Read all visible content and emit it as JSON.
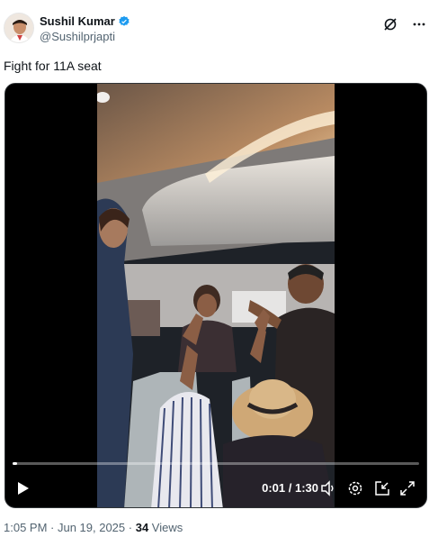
{
  "author": {
    "name": "Sushil Kumar",
    "handle": "@Sushilprjapti",
    "verified": true
  },
  "header_icons": [
    "grok-icon",
    "more-icon"
  ],
  "tweet": {
    "text": "Fight for 11A seat"
  },
  "video": {
    "progress": 0.01,
    "time_label": "0:01 / 1:30",
    "controls": [
      "play-icon",
      "volume-icon",
      "settings-icon",
      "picture-in-picture-icon",
      "fullscreen-icon"
    ]
  },
  "meta": {
    "timestamp": "1:05 PM · Jun 19, 2025",
    "separator": " · ",
    "views_count": "34",
    "views_label": " Views"
  },
  "colors": {
    "verified_blue": "#1d9bf0",
    "secondary_text": "#536471",
    "video_bg": "#000000"
  }
}
